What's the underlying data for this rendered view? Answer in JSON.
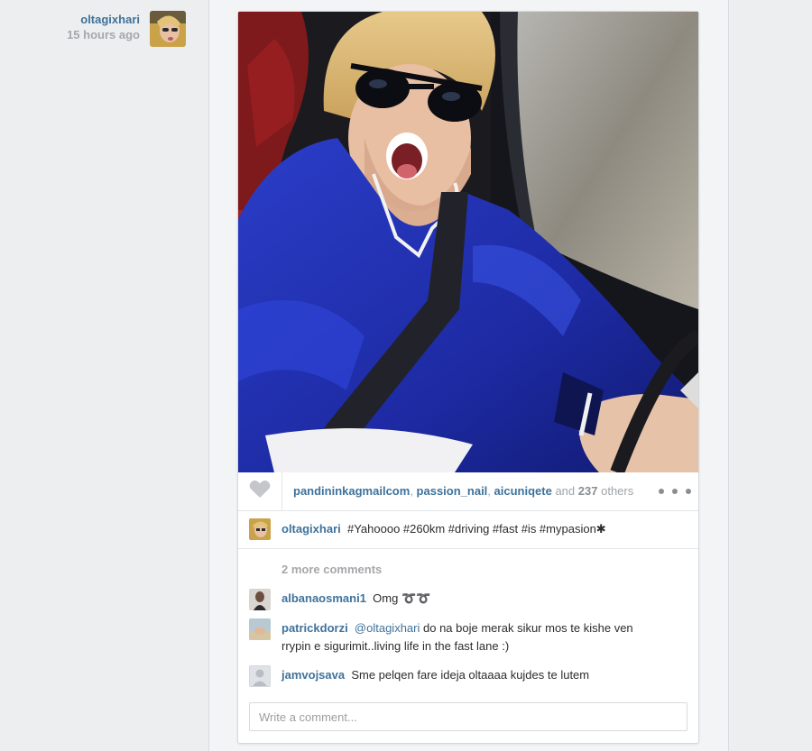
{
  "post": {
    "author": "oltagixhari",
    "time": "15 hours ago"
  },
  "likes": {
    "users": [
      "pandininkagmailcom",
      "passion_nail",
      "aicuniqete"
    ],
    "and_text": "and",
    "count": "237",
    "others_text": "others"
  },
  "caption": {
    "user": "oltagixhari",
    "text": "#Yahoooo #260km #driving #fast #is #mypasion✱"
  },
  "comments": {
    "more_label": "2 more comments",
    "items": [
      {
        "user": "albanaosmani1",
        "text": "Omg ➰➰"
      },
      {
        "user": "patrickdorzi",
        "mention": "@oltagixhari",
        "text": "do na boje merak sikur mos te kishe ven",
        "text2": "rrypin e sigurimit..living life in the fast lane :)"
      },
      {
        "user": "jamvojsava",
        "text": "Sme pelqen fare ideja oltaaaa kujdes te lutem"
      }
    ]
  },
  "comment_input": {
    "placeholder": "Write a comment..."
  },
  "icons": {
    "like": "heart-icon",
    "more": "more-options-icon"
  },
  "colors": {
    "link": "#3f729b",
    "muted": "#a5a7aa",
    "jacket": "#1f2fb0"
  }
}
